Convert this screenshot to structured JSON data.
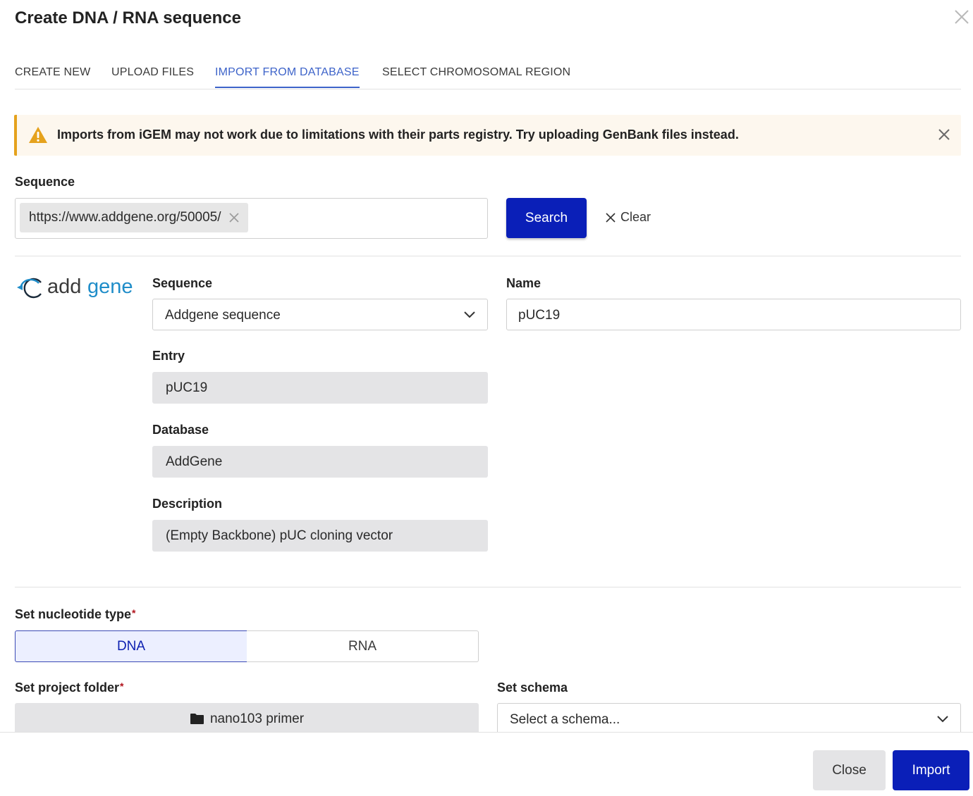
{
  "dialog": {
    "title": "Create DNA / RNA sequence"
  },
  "tabs": [
    {
      "label": "CREATE NEW",
      "active": false
    },
    {
      "label": "UPLOAD FILES",
      "active": false
    },
    {
      "label": "IMPORT FROM DATABASE",
      "active": true
    },
    {
      "label": "SELECT CHROMOSOMAL REGION",
      "active": false
    }
  ],
  "alert": {
    "message": "Imports from iGEM may not work due to limitations with their parts registry. Try uploading GenBank files instead.",
    "accent_color": "#e5a21d",
    "icon": "warning-icon"
  },
  "search": {
    "label": "Sequence",
    "chip_value": "https://www.addgene.org/50005/",
    "search_label": "Search",
    "clear_label": "Clear"
  },
  "result": {
    "logo_text_prefix": "add",
    "logo_text_suffix": "gene",
    "sequence_label": "Sequence",
    "sequence_value": "Addgene sequence",
    "name_label": "Name",
    "name_value": "pUC19",
    "entry_label": "Entry",
    "entry_value": "pUC19",
    "database_label": "Database",
    "database_value": "AddGene",
    "description_label": "Description",
    "description_value": "(Empty Backbone) pUC cloning vector"
  },
  "settings": {
    "nucleotide_label": "Set nucleotide type",
    "required_mark": "*",
    "options": [
      "DNA",
      "RNA"
    ],
    "selected_option": "DNA",
    "folder_label": "Set project folder",
    "folder_value": "nano103 primer",
    "schema_label": "Set schema",
    "schema_placeholder": "Select a schema..."
  },
  "footer": {
    "close_label": "Close",
    "import_label": "Import"
  },
  "colors": {
    "primary": "#0a1fb8",
    "active_tab": "#3d63c9",
    "addgene_blue": "#1f8dc9"
  }
}
